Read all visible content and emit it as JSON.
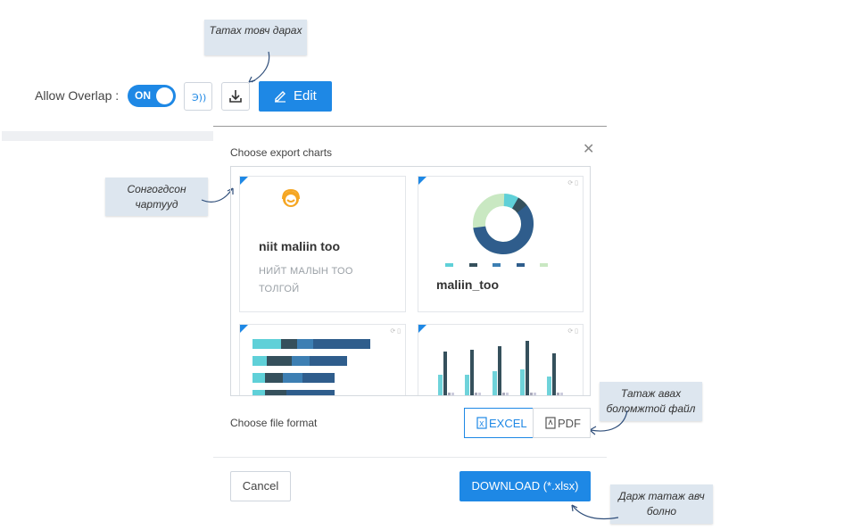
{
  "toolbar": {
    "allow_overlap_label": "Allow Overlap :",
    "toggle_label": "ON",
    "toggle_on": true,
    "edit_label": "Edit"
  },
  "callouts": {
    "download_button": "Татах товч дарах",
    "selected_charts": "Сонгогдсон чартууд",
    "available_files": "Татаж авах боломжтой файл",
    "press_download": "Дарж татаж авч болно"
  },
  "dialog": {
    "title": "Choose export charts",
    "cards": [
      {
        "title": "niit maliin too",
        "subtitle": "НИЙТ МАЛЫН ТОО ТОЛГОЙ"
      },
      {
        "title": "maliin_too"
      }
    ],
    "file_format_label": "Choose file format",
    "formats": [
      {
        "label": "EXCEL",
        "selected": true
      },
      {
        "label": "PDF",
        "selected": false
      }
    ],
    "cancel_label": "Cancel",
    "download_label": "DOWNLOAD (*.xlsx)"
  },
  "colors": {
    "accent": "#1e88e5",
    "donut_dark": "#2f5d8c",
    "donut_light": "#c9e8c2",
    "donut_teal": "#5fd0d8",
    "bar_dark": "#35505c"
  },
  "icons": [
    "download-icon",
    "edit-pencil-icon",
    "close-icon",
    "excel-file-icon",
    "pdf-file-icon",
    "audio-icon",
    "user-headset-icon"
  ]
}
